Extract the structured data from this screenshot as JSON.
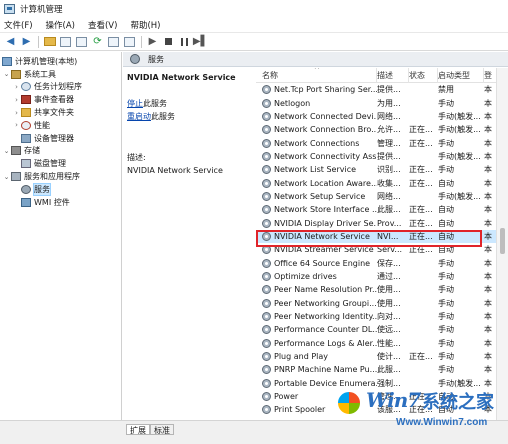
{
  "window": {
    "title": "计算机管理"
  },
  "menu": [
    "文件(F)",
    "操作(A)",
    "查看(V)",
    "帮助(H)"
  ],
  "tree": {
    "root": "计算机管理(本地)",
    "system_tools": "系统工具",
    "task_scheduler": "任务计划程序",
    "event_viewer": "事件查看器",
    "shared_folders": "共享文件夹",
    "performance": "性能",
    "device_manager": "设备管理器",
    "storage": "存储",
    "disk_management": "磁盘管理",
    "services_apps": "服务和应用程序",
    "services": "服务",
    "wmi": "WMI 控件"
  },
  "panel_header": "服务",
  "detail": {
    "service_title": "NVIDIA Network Service",
    "stop_link": "停止",
    "stop_suffix": "此服务",
    "restart_link": "重启动",
    "restart_suffix": "此服务",
    "desc_label": "描述:",
    "desc_text": "NVIDIA Network Service"
  },
  "columns": {
    "name": "名称",
    "description": "描述",
    "status": "状态",
    "startup": "启动类型",
    "logon": "登"
  },
  "services": [
    {
      "name": "Net.Tcp Port Sharing Ser...",
      "desc": "提供...",
      "status": "",
      "startup": "禁用",
      "logon": "本"
    },
    {
      "name": "Netlogon",
      "desc": "为用...",
      "status": "",
      "startup": "手动",
      "logon": "本"
    },
    {
      "name": "Network Connected Devi...",
      "desc": "网络...",
      "status": "",
      "startup": "手动(触发...",
      "logon": "本"
    },
    {
      "name": "Network Connection Bro...",
      "desc": "允许...",
      "status": "正在...",
      "startup": "手动(触发...",
      "logon": "本"
    },
    {
      "name": "Network Connections",
      "desc": "管理...",
      "status": "正在...",
      "startup": "手动",
      "logon": "本"
    },
    {
      "name": "Network Connectivity Ass...",
      "desc": "提供...",
      "status": "",
      "startup": "手动(触发...",
      "logon": "本"
    },
    {
      "name": "Network List Service",
      "desc": "识别...",
      "status": "正在...",
      "startup": "手动",
      "logon": "本"
    },
    {
      "name": "Network Location Aware...",
      "desc": "收集...",
      "status": "正在...",
      "startup": "自动",
      "logon": "本"
    },
    {
      "name": "Network Setup Service",
      "desc": "网络...",
      "status": "",
      "startup": "手动(触发...",
      "logon": "本"
    },
    {
      "name": "Network Store Interface ...",
      "desc": "此服...",
      "status": "正在...",
      "startup": "自动",
      "logon": "本"
    },
    {
      "name": "NVIDIA Display Driver Se...",
      "desc": "Prov...",
      "status": "正在...",
      "startup": "自动",
      "logon": "本"
    },
    {
      "name": "NVIDIA Network Service",
      "desc": "NVI...",
      "status": "正在...",
      "startup": "自动",
      "logon": "本"
    },
    {
      "name": "NVIDIA Streamer Service",
      "desc": "Serv...",
      "status": "正在...",
      "startup": "自动",
      "logon": "本"
    },
    {
      "name": "Office 64 Source Engine",
      "desc": "保存...",
      "status": "",
      "startup": "手动",
      "logon": "本"
    },
    {
      "name": "Optimize drives",
      "desc": "通过...",
      "status": "",
      "startup": "手动",
      "logon": "本"
    },
    {
      "name": "Peer Name Resolution Pr...",
      "desc": "使用...",
      "status": "",
      "startup": "手动",
      "logon": "本"
    },
    {
      "name": "Peer Networking Groupi...",
      "desc": "使用...",
      "status": "",
      "startup": "手动",
      "logon": "本"
    },
    {
      "name": "Peer Networking Identity...",
      "desc": "向对...",
      "status": "",
      "startup": "手动",
      "logon": "本"
    },
    {
      "name": "Performance Counter DL...",
      "desc": "使远...",
      "status": "",
      "startup": "手动",
      "logon": "本"
    },
    {
      "name": "Performance Logs & Aler...",
      "desc": "性能...",
      "status": "",
      "startup": "手动",
      "logon": "本"
    },
    {
      "name": "Plug and Play",
      "desc": "使计...",
      "status": "正在...",
      "startup": "手动",
      "logon": "本"
    },
    {
      "name": "PNRP Machine Name Pu...",
      "desc": "此服...",
      "status": "",
      "startup": "手动",
      "logon": "本"
    },
    {
      "name": "Portable Device Enumera...",
      "desc": "强制...",
      "status": "",
      "startup": "手动(触发...",
      "logon": "本"
    },
    {
      "name": "Power",
      "desc": "管理...",
      "status": "正在...",
      "startup": "自动",
      "logon": "本"
    },
    {
      "name": "Print Spooler",
      "desc": "该服...",
      "status": "正在...",
      "startup": "自动",
      "logon": "本"
    }
  ],
  "selected_service": "NVIDIA Network Service",
  "bottom_tabs": [
    "扩展",
    "标准"
  ],
  "watermark": {
    "brand": "Win7",
    "brand_cn": "系统之家",
    "url": "Www.Winwin7.com"
  },
  "colors": {
    "highlight_border": "#e0242a",
    "selection": "#cce8ff",
    "link": "#0645ad"
  }
}
